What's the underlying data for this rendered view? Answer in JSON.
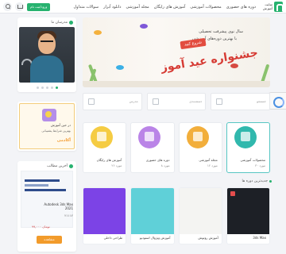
{
  "topbar": {
    "logo_text": "سایت آموزش",
    "nav": [
      "دوره های حضوری",
      "محصولات آموزشی",
      "آموزش های رایگان",
      "مجله آموزشی",
      "دانلود آبزار",
      "سوالات متداول"
    ],
    "login_label": "ورود/ثبت نام",
    "icons": [
      "search-icon",
      "cart-icon"
    ]
  },
  "sidebar": {
    "teachers_title": "مدرسان ما",
    "promo": {
      "title": "در حین آموزش",
      "subtitle": "بهترین شرایط پشتیبانی",
      "brand": "آکادمی"
    },
    "latest": {
      "title": "آخرین مطالب",
      "course_name": "Autodesk 3ds Max 2021",
      "course_sub": "۲۱۱۱۲",
      "price": "۹۹,۰۰۰ تومان",
      "buy_label": "مشاهده"
    }
  },
  "hero": {
    "slogan1": "سال نوی پیشرفت تحصیلی",
    "slogan2": "با بهترین دوره‌های آموزشی",
    "start_label": "شروع کنید",
    "headline": "جشنواره عید آموز"
  },
  "search": {
    "fields": [
      "جستجو",
      "دسته‌بندی",
      "مدرس"
    ]
  },
  "categories": [
    {
      "label": "محصولات آموزشی",
      "count": "۳۰ مورد",
      "color": "#31b8ad"
    },
    {
      "label": "مجله آموزشی",
      "count": "۱۲ مورد",
      "color": "#f2ae3b"
    },
    {
      "label": "دوره های حضوری",
      "count": "۸ مورد",
      "color": "#ba84e7"
    },
    {
      "label": "آموزش های رایگان",
      "count": "۲۶ مورد",
      "color": "#f5cc43"
    }
  ],
  "section": {
    "title": "جدیدترین دوره ها"
  },
  "courses": [
    {
      "title": "3ds Max",
      "color": "#1d2026"
    },
    {
      "title": "آموزش روتوش",
      "color": "#f4f4f2"
    },
    {
      "title": "آموزش ویژوال استودیو",
      "color": "#5fd0d8"
    },
    {
      "title": "طراحی داخلی",
      "color": "#7c43e6"
    }
  ]
}
